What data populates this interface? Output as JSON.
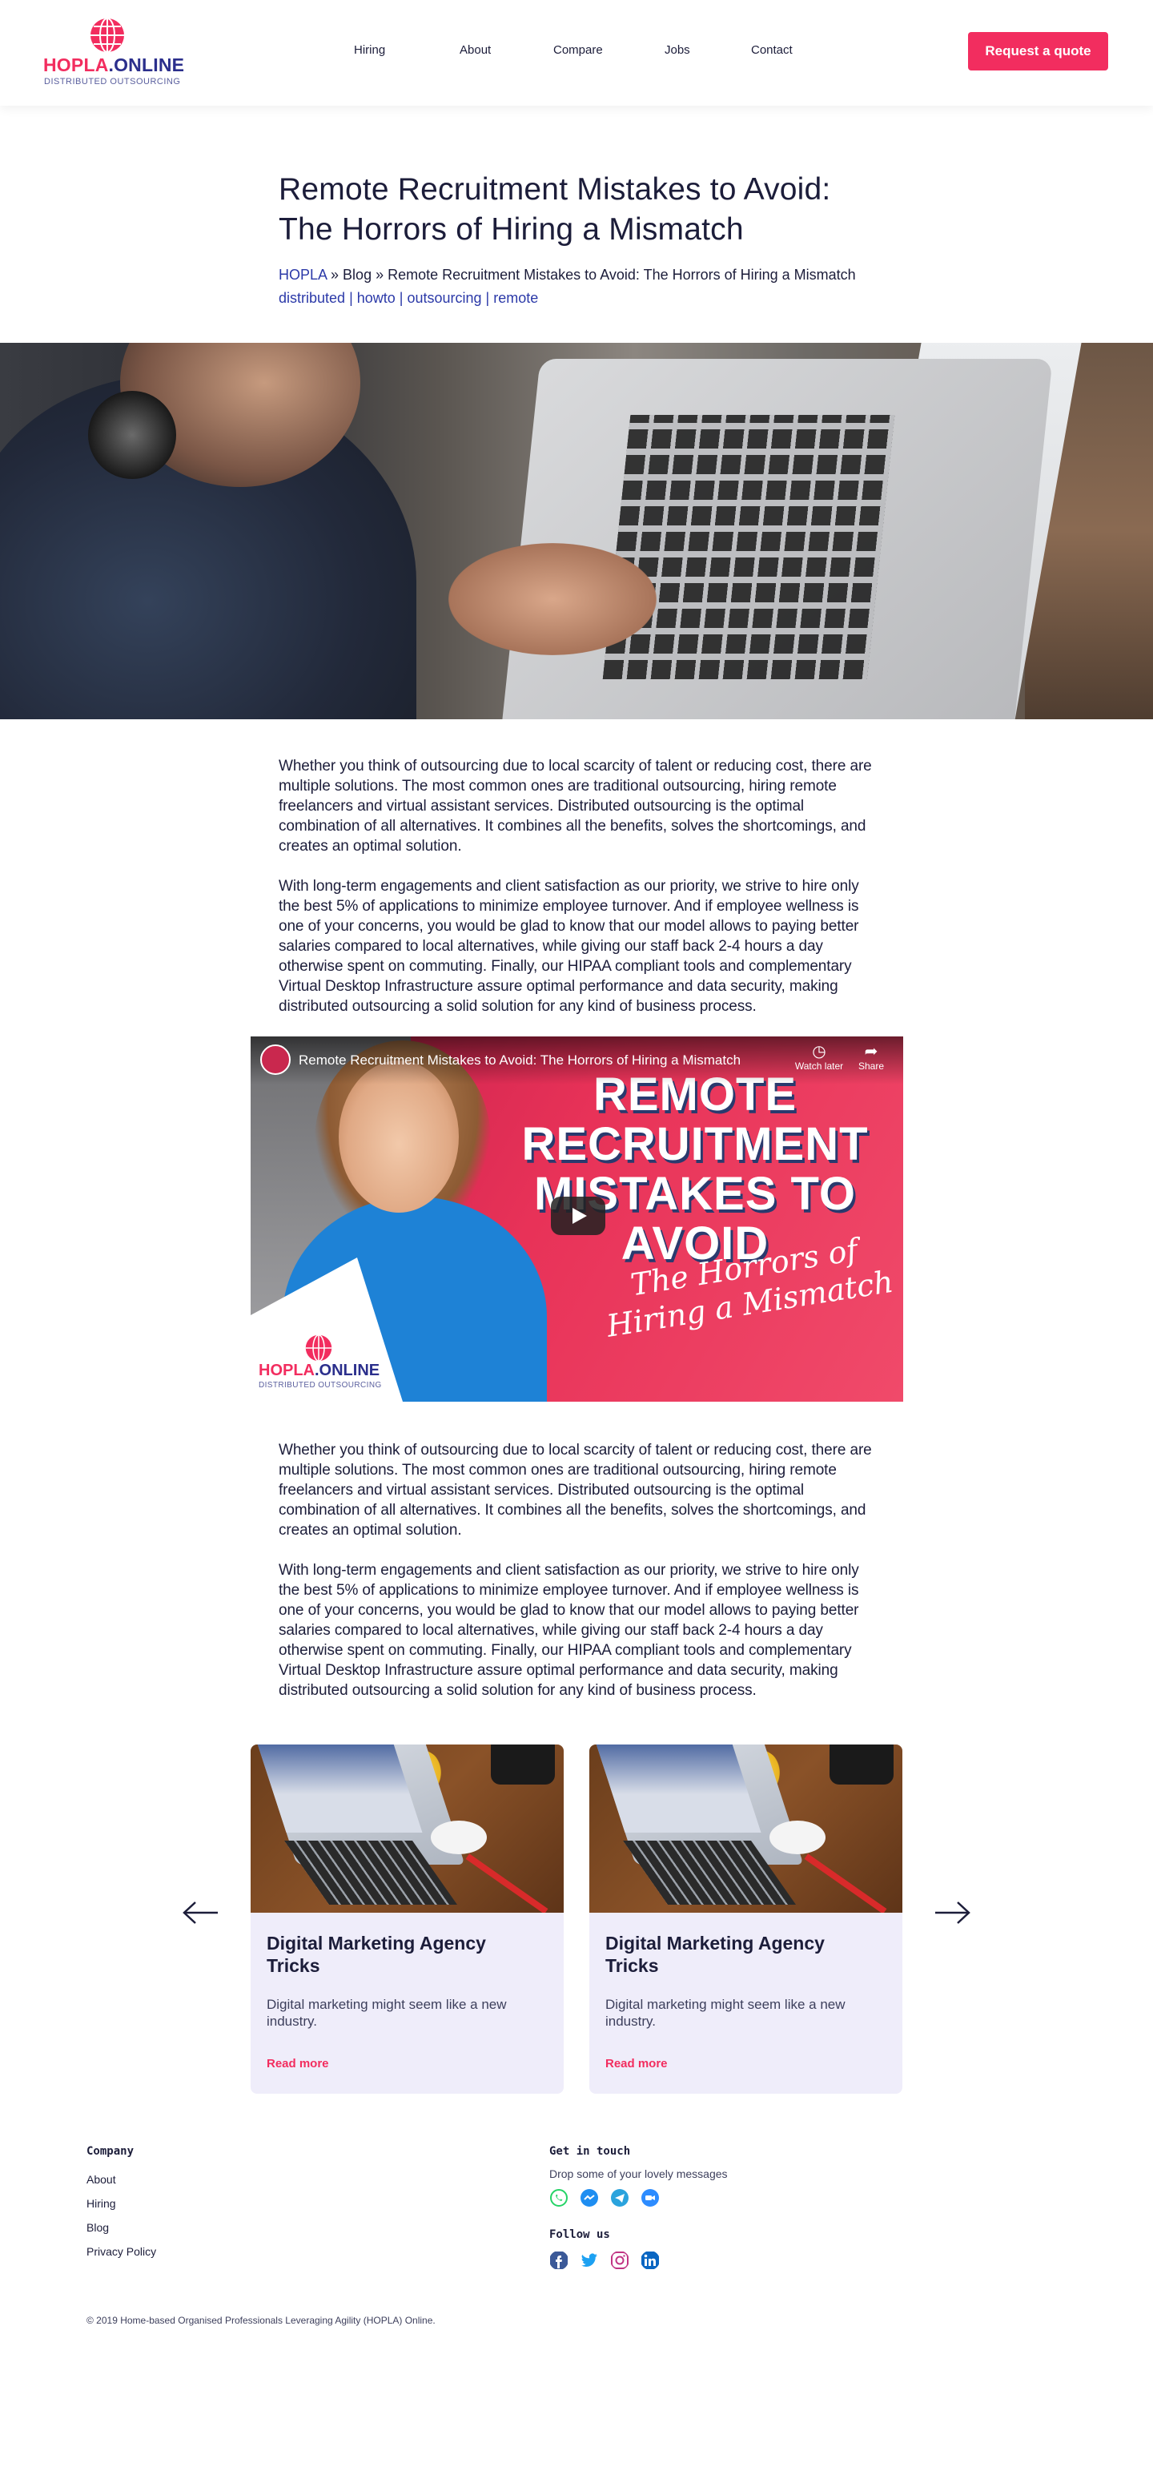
{
  "header": {
    "brand_part1": "HOPLA",
    "brand_part2": ".ONLINE",
    "brand_tagline": "DISTRIBUTED OUTSOURCING",
    "nav": [
      "Hiring",
      "About",
      "Compare",
      "Jobs",
      "Contact"
    ],
    "cta_label": "Request a quote"
  },
  "article": {
    "title": "Remote Recruitment Mistakes to Avoid: The Horrors of Hiring a Mismatch",
    "breadcrumb": {
      "home": "HOPLA",
      "sep": " » ",
      "blog": "Blog",
      "current": "Remote Recruitment Mistakes to Avoid: The Horrors of Hiring a Mismatch"
    },
    "tags": [
      "distributed",
      "howto",
      "outsourcing",
      "remote"
    ],
    "tag_sep": " | ",
    "paragraph1": "Whether you think of outsourcing due to local scarcity of talent or reducing cost, there are multiple solutions. The most common ones are traditional outsourcing, hiring remote freelancers and virtual assistant services. Distributed outsourcing is the optimal combination of all alternatives. It combines all the benefits, solves the shortcomings, and creates an optimal solution.",
    "paragraph2": "With long-term engagements and client satisfaction as our priority, we strive to hire only the best 5% of applications to minimize employee turnover. And if employee wellness is one of your concerns, you would be glad to know that our model allows to paying better salaries compared to local alternatives, while giving our staff back 2-4 hours a day otherwise spent on commuting. Finally, our HIPAA compliant tools and complementary Virtual Desktop Infrastructure assure optimal performance and data security, making distributed outsourcing a solid solution for any kind of business process."
  },
  "video": {
    "title": "Remote Recruitment Mistakes to Avoid: The Horrors of Hiring a Mismatch",
    "watch_later": "Watch later",
    "share": "Share",
    "thumb_line1": "REMOTE",
    "thumb_line2": "RECRUITMENT",
    "thumb_line3": "MISTAKES TO",
    "thumb_line4": "AVOID",
    "thumb_script1": "The Horrors of",
    "thumb_script2": "Hiring a Mismatch",
    "thumb_brand1": "HOPLA",
    "thumb_brand2": ".ONLINE",
    "thumb_tagline": "DISTRIBUTED OUTSOURCING"
  },
  "cards": [
    {
      "title": "Digital Marketing Agency Tricks",
      "desc": "Digital marketing might seem like a new industry.",
      "more": "Read more"
    },
    {
      "title": "Digital Marketing Agency Tricks",
      "desc": "Digital marketing might seem like a new industry.",
      "more": "Read more"
    }
  ],
  "footer": {
    "company_heading": "Company",
    "company_links": [
      "About",
      "Hiring",
      "Blog",
      "Privacy Policy"
    ],
    "contact_heading": "Get in touch",
    "contact_note": "Drop some of your lovely messages",
    "contact_icons": [
      "whatsapp-icon",
      "messenger-icon",
      "telegram-icon",
      "zoom-icon"
    ],
    "follow_heading": "Follow us",
    "social_icons": [
      "facebook-icon",
      "twitter-icon",
      "instagram-icon",
      "linkedin-icon"
    ],
    "copyright": "© 2019 Home-based Organised Professionals Leveraging Agility (HOPLA) Online."
  },
  "colors": {
    "accent": "#f22d5f",
    "brand_blue": "#2b2f8c",
    "link": "#2b39a8",
    "card_bg": "#efedfa",
    "text": "#1c1d3a"
  }
}
